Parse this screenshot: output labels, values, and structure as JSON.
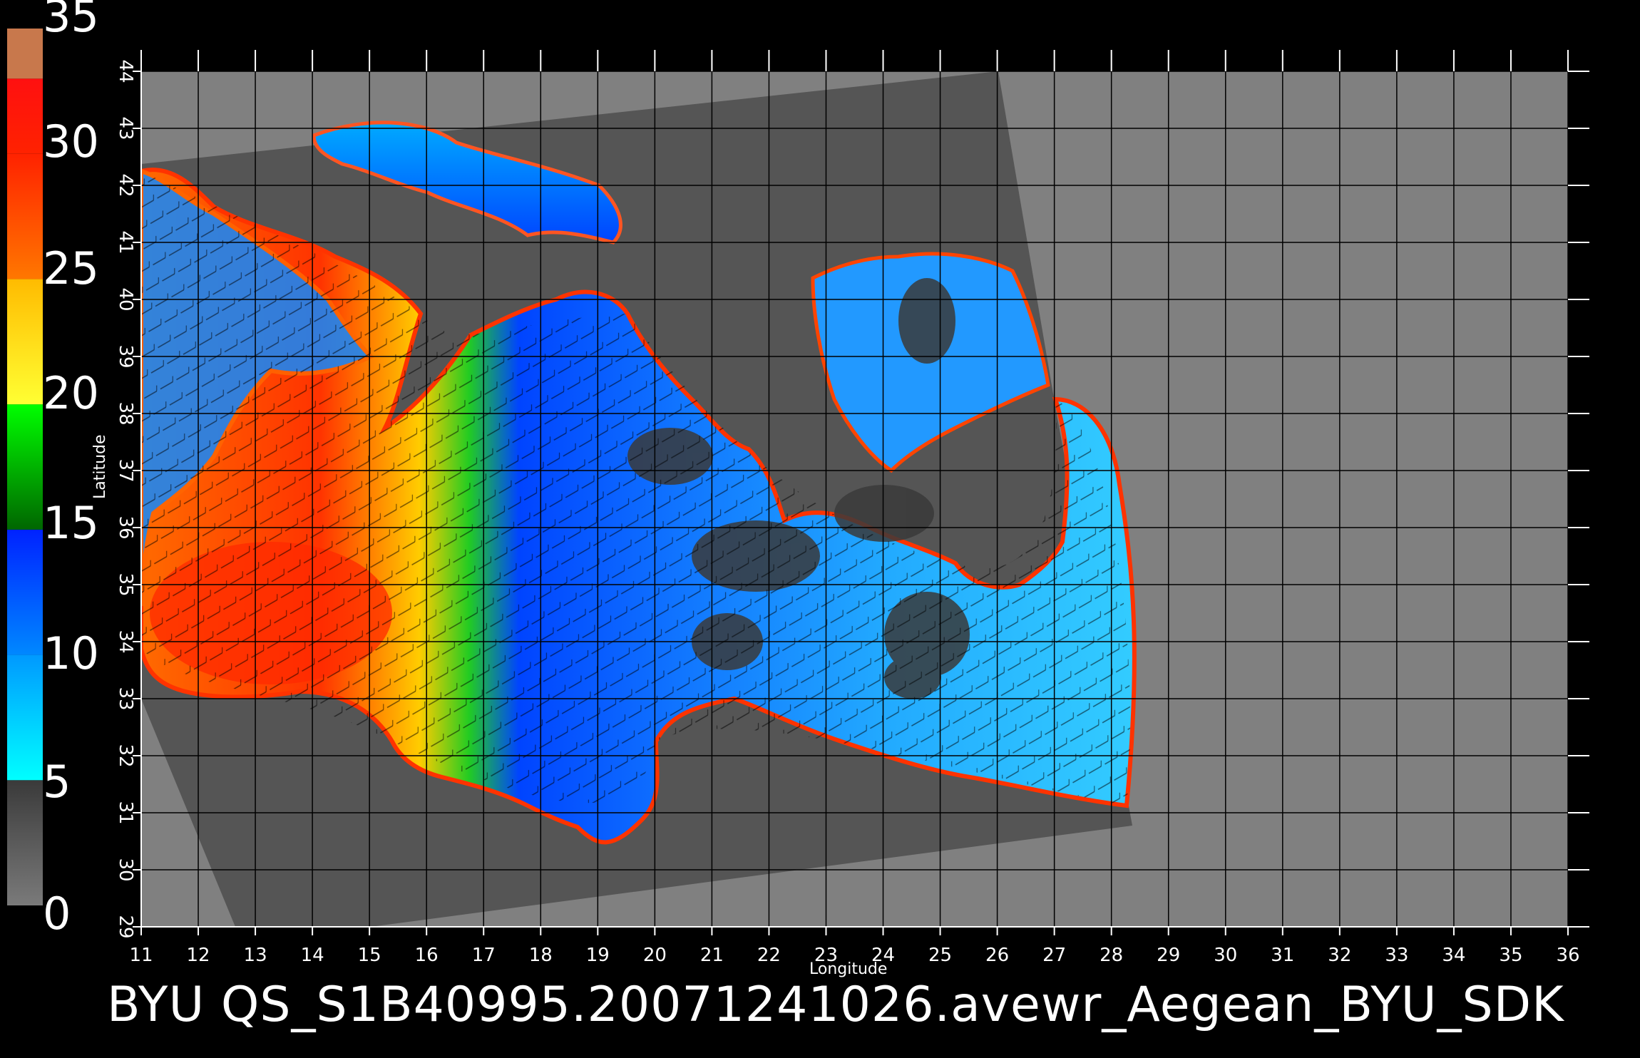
{
  "title": "BYU  QS_S1B40995.20071241026.avewr_Aegean_BYU_SDK",
  "colorbar": {
    "labels": [
      "35",
      "30",
      "25",
      "20",
      "15",
      "10",
      "5",
      "0"
    ],
    "min": 0,
    "max": 35,
    "stops": [
      {
        "from": 0,
        "to": 5,
        "colors": [
          "#7a7a7a",
          "#3a3a3a"
        ]
      },
      {
        "from": 5,
        "to": 10,
        "colors": [
          "#00ffff",
          "#0099ff"
        ]
      },
      {
        "from": 10,
        "to": 15,
        "colors": [
          "#0088ff",
          "#0022ff"
        ]
      },
      {
        "from": 15,
        "to": 20,
        "colors": [
          "#006600",
          "#00ff00"
        ]
      },
      {
        "from": 20,
        "to": 25,
        "colors": [
          "#ffff33",
          "#ffbb00"
        ]
      },
      {
        "from": 25,
        "to": 30,
        "colors": [
          "#ff7700",
          "#ff2200"
        ]
      },
      {
        "from": 30,
        "to": 33,
        "colors": [
          "#ff2200",
          "#ff1010"
        ]
      },
      {
        "from": 33,
        "to": 35,
        "colors": [
          "#c8784c",
          "#c8784c"
        ]
      }
    ]
  },
  "map": {
    "xlabel": "Longitude",
    "ylabel": "Latitude",
    "lon_ticks": [
      "11",
      "12",
      "13",
      "14",
      "15",
      "16",
      "17",
      "18",
      "19",
      "20",
      "21",
      "22",
      "23",
      "24",
      "25",
      "26",
      "27",
      "28",
      "29",
      "30",
      "31",
      "32",
      "33",
      "34",
      "35",
      "36"
    ],
    "lat_ticks": [
      "44",
      "43",
      "42",
      "41",
      "40",
      "39",
      "38",
      "37",
      "36",
      "35",
      "34",
      "33",
      "32",
      "31",
      "30",
      "29"
    ],
    "lon_range": [
      11,
      36
    ],
    "lat_range": [
      29,
      44
    ],
    "colors": {
      "background": "#000000",
      "no_data": "#808080",
      "land": "#555555",
      "grid": "#000000"
    }
  }
}
